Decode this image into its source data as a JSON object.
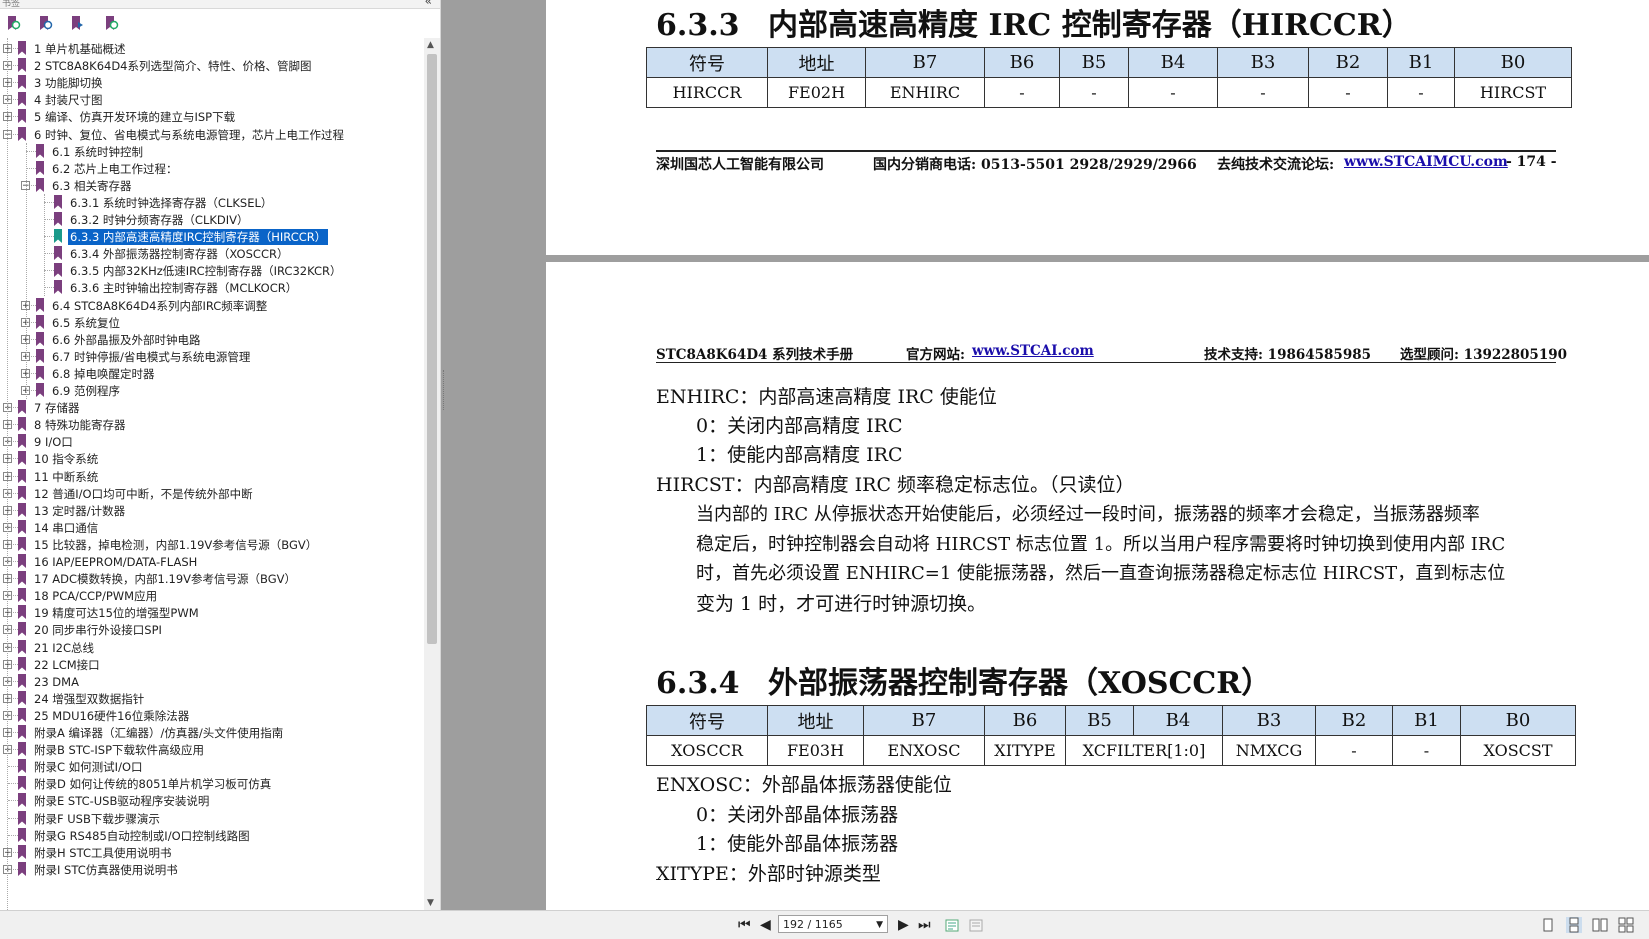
{
  "sidebar": {
    "header_title": "书签",
    "collapse_glyph": "«",
    "toolbar_icons": [
      "bookmark-options-icon",
      "expand-bookmark-icon",
      "add-bookmark-icon",
      "find-bookmark-icon"
    ],
    "items": [
      {
        "label": "1 单片机基础概述",
        "level": 0,
        "expander": "+"
      },
      {
        "label": "2  STC8A8K64D4系列选型简介、特性、价格、管脚图",
        "level": 0,
        "expander": "+"
      },
      {
        "label": "3  功能脚切换",
        "level": 0,
        "expander": "+"
      },
      {
        "label": "4  封装尺寸图",
        "level": 0,
        "expander": "+"
      },
      {
        "label": "5  编译、仿真开发环境的建立与ISP下载",
        "level": 0,
        "expander": "+"
      },
      {
        "label": "6  时钟、复位、省电模式与系统电源管理，芯片上电工作过程",
        "level": 0,
        "expander": "−"
      },
      {
        "label": "6.1  系统时钟控制",
        "level": 1,
        "expander": ""
      },
      {
        "label": "6.2  芯片上电工作过程：",
        "level": 1,
        "expander": ""
      },
      {
        "label": "6.3  相关寄存器",
        "level": 1,
        "expander": "−"
      },
      {
        "label": "6.3.1  系统时钟选择寄存器（CLKSEL）",
        "level": 2,
        "expander": ""
      },
      {
        "label": "6.3.2  时钟分频寄存器（CLKDIV）",
        "level": 2,
        "expander": ""
      },
      {
        "label": "6.3.3  内部高速高精度IRC控制寄存器（HIRCCR）",
        "level": 2,
        "expander": "",
        "selected": true
      },
      {
        "label": "6.3.4  外部振荡器控制寄存器（XOSCCR）",
        "level": 2,
        "expander": ""
      },
      {
        "label": "6.3.5  内部32KHz低速IRC控制寄存器（IRC32KCR）",
        "level": 2,
        "expander": ""
      },
      {
        "label": "6.3.6  主时钟输出控制寄存器（MCLKOCR）",
        "level": 2,
        "expander": ""
      },
      {
        "label": "6.4  STC8A8K64D4系列内部IRC频率调整",
        "level": 1,
        "expander": "+"
      },
      {
        "label": "6.5  系统复位",
        "level": 1,
        "expander": "+"
      },
      {
        "label": "6.6  外部晶振及外部时钟电路",
        "level": 1,
        "expander": "+"
      },
      {
        "label": "6.7  时钟停振/省电模式与系统电源管理",
        "level": 1,
        "expander": "+"
      },
      {
        "label": "6.8  掉电唤醒定时器",
        "level": 1,
        "expander": "+"
      },
      {
        "label": "6.9  范例程序",
        "level": 1,
        "expander": "+"
      },
      {
        "label": "7  存储器",
        "level": 0,
        "expander": "+"
      },
      {
        "label": "8  特殊功能寄存器",
        "level": 0,
        "expander": "+"
      },
      {
        "label": "9  I/O口",
        "level": 0,
        "expander": "+"
      },
      {
        "label": "10  指令系统",
        "level": 0,
        "expander": "+"
      },
      {
        "label": "11  中断系统",
        "level": 0,
        "expander": "+"
      },
      {
        "label": "12  普通I/O口均可中断，不是传统外部中断",
        "level": 0,
        "expander": "+"
      },
      {
        "label": "13  定时器/计数器",
        "level": 0,
        "expander": "+"
      },
      {
        "label": "14  串口通信",
        "level": 0,
        "expander": "+"
      },
      {
        "label": "15  比较器，掉电检测，内部1.19V参考信号源（BGV）",
        "level": 0,
        "expander": "+"
      },
      {
        "label": "16  IAP/EEPROM/DATA-FLASH",
        "level": 0,
        "expander": "+"
      },
      {
        "label": "17  ADC模数转换，内部1.19V参考信号源（BGV）",
        "level": 0,
        "expander": "+"
      },
      {
        "label": "18  PCA/CCP/PWM应用",
        "level": 0,
        "expander": "+"
      },
      {
        "label": "19  精度可达15位的增强型PWM",
        "level": 0,
        "expander": "+"
      },
      {
        "label": "20  同步串行外设接口SPI",
        "level": 0,
        "expander": "+"
      },
      {
        "label": "21  I2C总线",
        "level": 0,
        "expander": "+"
      },
      {
        "label": "22  LCM接口",
        "level": 0,
        "expander": "+"
      },
      {
        "label": "23  DMA",
        "level": 0,
        "expander": "+"
      },
      {
        "label": "24  增强型双数据指针",
        "level": 0,
        "expander": "+"
      },
      {
        "label": "25  MDU16硬件16位乘除法器",
        "level": 0,
        "expander": "+"
      },
      {
        "label": "附录A  编译器（汇编器）/仿真器/头文件使用指南",
        "level": 0,
        "expander": "+"
      },
      {
        "label": "附录B  STC-ISP下载软件高级应用",
        "level": 0,
        "expander": "+"
      },
      {
        "label": "附录C  如何测试I/O口",
        "level": 0,
        "expander": ""
      },
      {
        "label": "附录D  如何让传统的8051单片机学习板可仿真",
        "level": 0,
        "expander": ""
      },
      {
        "label": "附录E  STC-USB驱动程序安装说明",
        "level": 0,
        "expander": ""
      },
      {
        "label": "附录F  USB下载步骤演示",
        "level": 0,
        "expander": ""
      },
      {
        "label": "附录G  RS485自动控制或I/O口控制线路图",
        "level": 0,
        "expander": ""
      },
      {
        "label": "附录H  STC工具使用说明书",
        "level": 0,
        "expander": "+"
      },
      {
        "label": "附录I  STC仿真器使用说明书",
        "level": 0,
        "expander": "+"
      }
    ]
  },
  "page1": {
    "section_num": "6.3.3",
    "section_title": "内部高速高精度 IRC 控制寄存器（HIRCCR）",
    "table_headers": [
      "符号",
      "地址",
      "B7",
      "B6",
      "B5",
      "B4",
      "B3",
      "B2",
      "B1",
      "B0"
    ],
    "table_row": [
      "HIRCCR",
      "FE02H",
      "ENHIRC",
      "-",
      "-",
      "-",
      "-",
      "-",
      "-",
      "HIRCST"
    ],
    "footer_company": "深圳国芯人工智能有限公司",
    "footer_phone": "国内分销商电话: 0513-5501 2928/2929/2966",
    "footer_forum_label": "去纯技术交流论坛:",
    "footer_forum_link": "www.STCAIMCU.com",
    "footer_page": "- 174 -"
  },
  "page2": {
    "header_manual": "STC8A8K64D4 系列技术手册",
    "header_site_label": "官方网站:",
    "header_site_link": "www.STCAI.com",
    "header_support": "技术支持: 19864585985",
    "header_consult": "选型顾问: 13922805190",
    "lines": [
      "ENHIRC：内部高速高精度 IRC 使能位",
      "0：关闭内部高精度 IRC",
      "1：使能内部高精度 IRC",
      "HIRCST：内部高精度 IRC 频率稳定标志位。（只读位）",
      "当内部的 IRC 从停振状态开始使能后，必须经过一段时间，振荡器的频率才会稳定，当振荡器频率",
      "稳定后，时钟控制器会自动将 HIRCST 标志位置 1。所以当用户程序需要将时钟切换到使用内部 IRC",
      "时，首先必须设置 ENHIRC=1 使能振荡器，然后一直查询振荡器稳定标志位 HIRCST，直到标志位",
      "变为 1 时，才可进行时钟源切换。"
    ],
    "section_num": "6.3.4",
    "section_title": "外部振荡器控制寄存器（XOSCCR）",
    "table_headers": [
      "符号",
      "地址",
      "B7",
      "B6",
      "B5",
      "B4",
      "B3",
      "B2",
      "B1",
      "B0"
    ],
    "table_row": [
      "XOSCCR",
      "FE03H",
      "ENXOSC",
      "XITYPE",
      "XCFILTER[1:0]",
      "NMXCG",
      "-",
      "-",
      "XOSCST"
    ],
    "lines2": [
      "ENXOSC：外部晶体振荡器使能位",
      "0：关闭外部晶体振荡器",
      "1：使能外部晶体振荡器",
      "XITYPE：外部时钟源类型"
    ]
  },
  "statusbar": {
    "page_indicator": "192 / 1165",
    "first_glyph": "⏮",
    "prev_glyph": "◀",
    "next_glyph": "▶",
    "last_glyph": "⏭"
  },
  "colors": {
    "selection": "#0a64c8",
    "table_header_bg": "#cddff2",
    "bookmark": "#7b3f7e",
    "link": "#1a0dab",
    "viewer_bg": "#9e9e9e"
  }
}
